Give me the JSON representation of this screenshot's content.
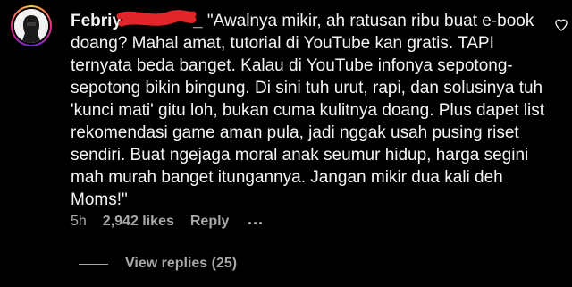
{
  "comment": {
    "username_visible": "Febriy",
    "username_suffix": "_",
    "text": "\"Awalnya mikir, ah ratusan ribu buat e-book doang? Mahal amat, tutorial di YouTube kan gratis. TAPI ternyata beda banget. Kalau di YouTube infonya sepotong-sepotong bikin bingung. Di sini tuh urut, rapi, dan solusinya tuh 'kunci mati' gitu loh, bukan cuma kulitnya doang. Plus dapet list rekomendasi game aman pula, jadi nggak usah pusing riset sendiri. Buat ngejaga moral anak seumur hidup, harga segini mah murah banget itungannya. Jangan mikir dua kali deh Moms!\"",
    "time": "5h",
    "likes": "2,942 likes",
    "reply_label": "Reply",
    "view_replies_label": "View replies (25)"
  },
  "icons": {
    "like": "heart-icon",
    "more": "more-options-icon",
    "avatar": "avatar"
  },
  "colors": {
    "background": "#000000",
    "text": "#f5f5f5",
    "secondary": "#a8a8a8",
    "redaction": "#e0262b"
  }
}
